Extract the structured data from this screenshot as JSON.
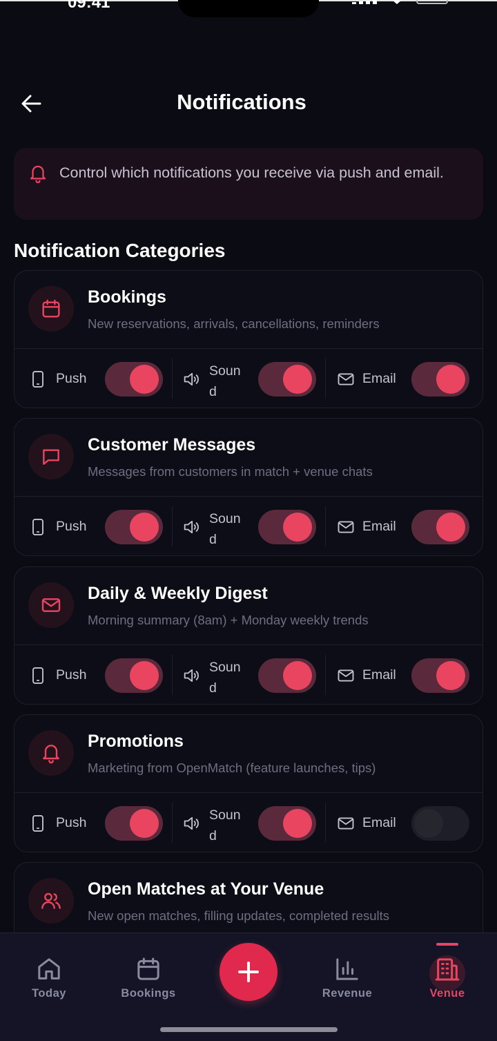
{
  "status_bar": {
    "time": "09:41"
  },
  "header": {
    "title": "Notifications"
  },
  "banner": {
    "text": "Control which notifications you receive via push and email."
  },
  "section_title": "Notification Categories",
  "labels": {
    "push": "Push",
    "sound": "Soun\nd",
    "email": "Email"
  },
  "categories": [
    {
      "title": "Bookings",
      "description": "New reservations, arrivals, cancellations, reminders",
      "icon": "calendar-icon",
      "push": true,
      "sound": true,
      "email": true
    },
    {
      "title": "Customer Messages",
      "description": "Messages from customers in match + venue chats",
      "icon": "message-icon",
      "push": true,
      "sound": true,
      "email": true
    },
    {
      "title": "Daily & Weekly Digest",
      "description": "Morning summary (8am) + Monday weekly trends",
      "icon": "mail-icon",
      "push": true,
      "sound": true,
      "email": true
    },
    {
      "title": "Promotions",
      "description": "Marketing from OpenMatch (feature launches, tips)",
      "icon": "bell-icon",
      "push": true,
      "sound": true,
      "email": false
    },
    {
      "title": "Open Matches at Your Venue",
      "description": "New open matches, filling updates, completed results",
      "icon": "users-icon"
    }
  ],
  "bottom_nav": {
    "today": "Today",
    "bookings": "Bookings",
    "revenue": "Revenue",
    "venue": "Venue",
    "active": "venue"
  },
  "colors": {
    "accent": "#e94560",
    "background": "#0b0b14",
    "card": "#0d0d17",
    "toggle_on_track": "#5a2a3c"
  }
}
